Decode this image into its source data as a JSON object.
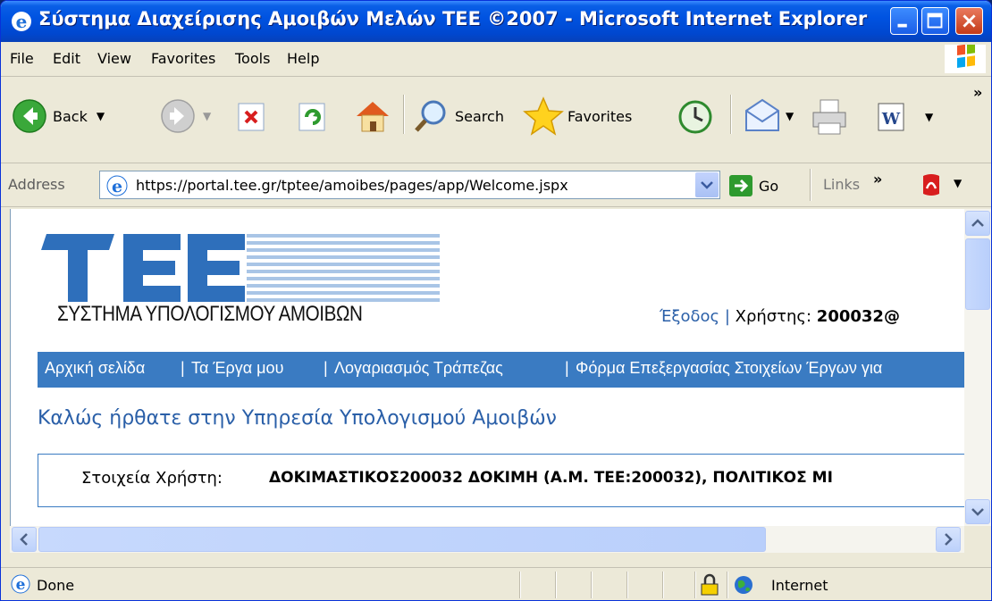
{
  "window": {
    "title": "Σύστημα Διαχείρισης Αμοιβών Μελών ΤΕΕ ©2007 - Microsoft Internet Explorer"
  },
  "menu": [
    "File",
    "Edit",
    "View",
    "Favorites",
    "Tools",
    "Help"
  ],
  "toolbar": {
    "back": "Back",
    "search": "Search",
    "favorites": "Favorites"
  },
  "address": {
    "label": "Address",
    "url": "https://portal.tee.gr/tptee/amoibes/pages/app/Welcome.jspx",
    "go": "Go",
    "links": "Links"
  },
  "page": {
    "logo_subtitle": "ΣΥΣΤΗΜΑ ΥΠΟΛΟΓΙΣΜΟΥ ΑΜΟΙΒΩΝ",
    "logout": "Έξοδος",
    "user_label": "Χρήστης:",
    "user_value": "200032@",
    "nav": [
      "Αρχική σελίδα",
      "Τα Έργα μου",
      "Λογαριασμός Τράπεζας",
      "Φόρμα Επεξεργασίας Στοιχείων Έργων για"
    ],
    "welcome": "Καλώς ήρθατε στην Υπηρεσία Υπολογισμού Αμοιβών",
    "user_info_label": "Στοιχεία Χρήστη:",
    "user_info_value": "ΔΟΚΙΜΑΣΤΙΚΟΣ200032 ΔΟΚΙΜΗ (Α.Μ. ΤΕΕ:200032), ΠΟΛΙΤΙΚΟΣ ΜΙ"
  },
  "status": {
    "text": "Done",
    "zone": "Internet"
  },
  "colors": {
    "nav_bg": "#3a7bc2",
    "link": "#2a5fa8",
    "title_bar": "#0053e1"
  }
}
